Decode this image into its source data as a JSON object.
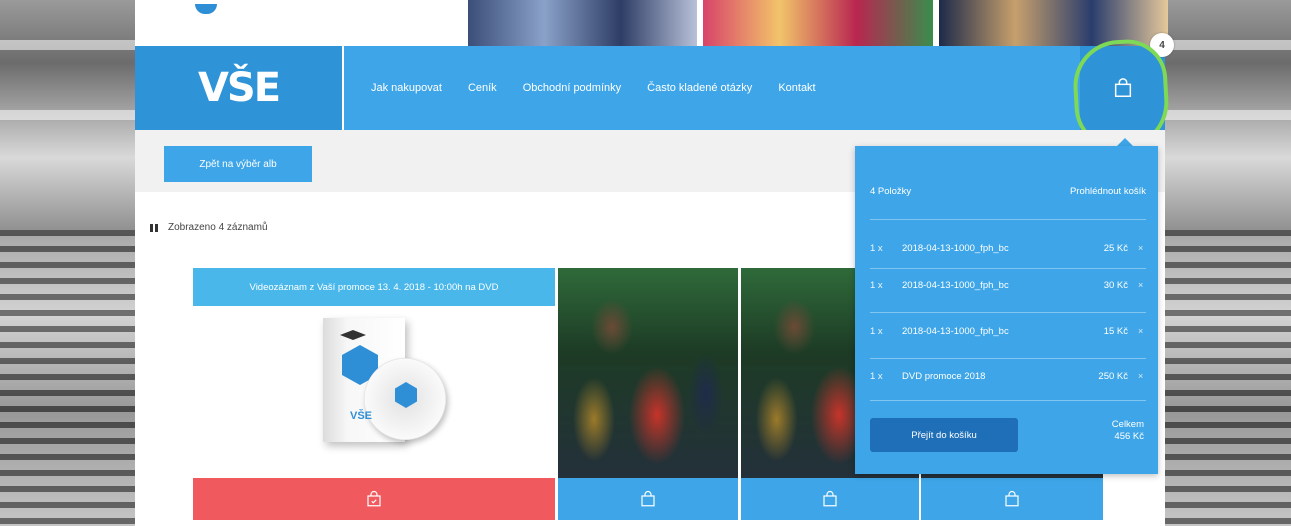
{
  "brand": {
    "logo_text": "VŠE"
  },
  "nav": {
    "items": [
      "Jak nakupovat",
      "Ceník",
      "Obchodní podmínky",
      "Často kladené otázky",
      "Kontakt"
    ],
    "cart_count": "4"
  },
  "back_button": "Zpět na výběr alb",
  "results": {
    "count_text": "Zobrazeno 4 záznamů"
  },
  "product": {
    "title": "Videozáznam z Vaší promoce 13. 4. 2018 - 10:00h na DVD",
    "dvd_label": "VŠE"
  },
  "cart": {
    "items_label": "4 Položky",
    "view_cart": "Prohlédnout košík",
    "items": [
      {
        "qty": "1 x",
        "name": "2018-04-13-1000_fph_bc",
        "price": "25 Kč",
        "remove": "×"
      },
      {
        "qty": "1 x",
        "name": "2018-04-13-1000_fph_bc",
        "price": "30 Kč",
        "remove": "×"
      },
      {
        "qty": "1 x",
        "name": "2018-04-13-1000_fph_bc",
        "price": "15 Kč",
        "remove": "×"
      },
      {
        "qty": "1 x",
        "name": "DVD promoce 2018",
        "price": "250 Kč",
        "remove": "×"
      }
    ],
    "checkout_button": "Přejít do košíku",
    "total_label": "Celkem",
    "total_value": "456 Kč"
  },
  "colors": {
    "primary": "#3ea6e8",
    "dark_primary": "#2f94d7",
    "accent_red": "#f05a5f",
    "highlight_green": "#7ed957"
  },
  "icons": {
    "cart": "shopping-bag-icon",
    "list": "grid-icon"
  }
}
